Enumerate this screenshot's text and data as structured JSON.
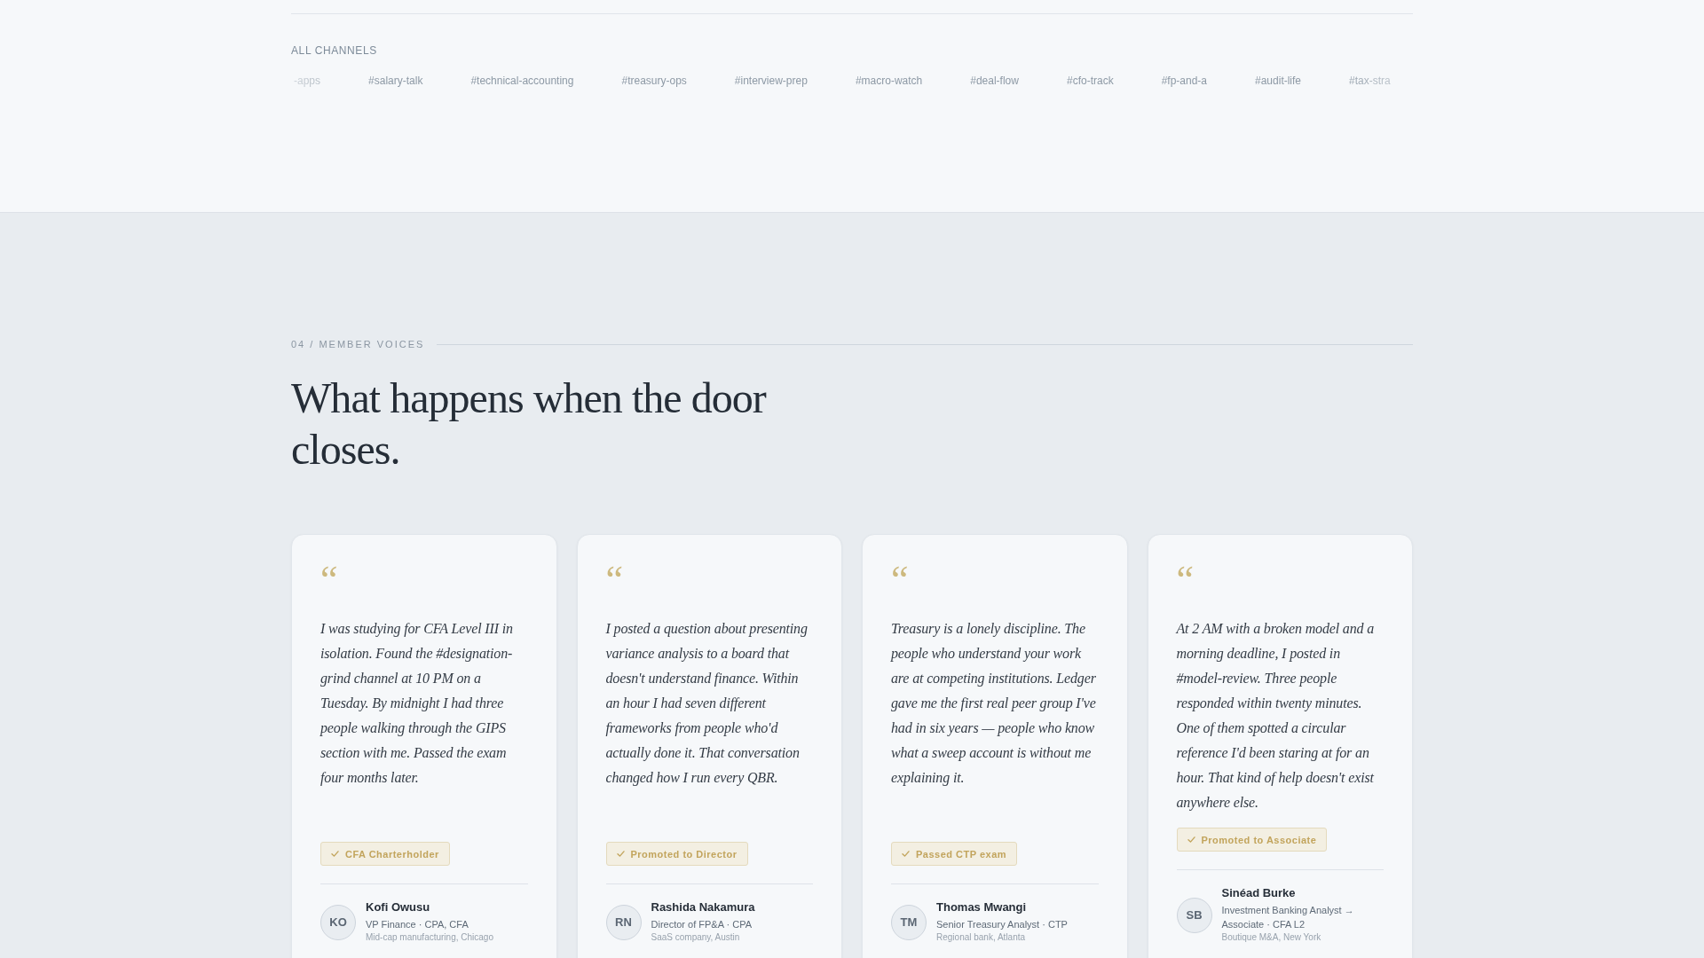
{
  "channels_strip": {
    "heading": "ALL CHANNELS",
    "channels": [
      "-apps",
      "#salary-talk",
      "#technical-accounting",
      "#treasury-ops",
      "#interview-prep",
      "#macro-watch",
      "#deal-flow",
      "#cfo-track",
      "#fp-and-a",
      "#audit-life",
      "#tax-stra"
    ]
  },
  "section": {
    "eyebrow": "04 / MEMBER VOICES",
    "title": "What happens when the door closes."
  },
  "testimonials": [
    {
      "quote_mark": "“",
      "quote": "I was studying for CFA Level III in isolation. Found the #designation-grind channel at 10 PM on a Tuesday. By midnight I had three people walking through the GIPS section with me. Passed the exam four months later.",
      "outcome": "CFA Charterholder",
      "initials": "KO",
      "name": "Kofi Owusu",
      "role": "VP Finance · CPA, CFA",
      "company": "Mid-cap manufacturing, Chicago"
    },
    {
      "quote_mark": "“",
      "quote": "I posted a question about presenting variance analysis to a board that doesn't understand finance. Within an hour I had seven different frameworks from people who'd actually done it. That conversation changed how I run every QBR.",
      "outcome": "Promoted to Director",
      "initials": "RN",
      "name": "Rashida Nakamura",
      "role": "Director of FP&A · CPA",
      "company": "SaaS company, Austin"
    },
    {
      "quote_mark": "“",
      "quote": "Treasury is a lonely discipline. The people who understand your work are at competing institutions. Ledger gave me the first real peer group I've had in six years — people who know what a sweep account is without me explaining it.",
      "outcome": "Passed CTP exam",
      "initials": "TM",
      "name": "Thomas Mwangi",
      "role": "Senior Treasury Analyst · CTP",
      "company": "Regional bank, Atlanta"
    },
    {
      "quote_mark": "“",
      "quote": "At 2 AM with a broken model and a morning deadline, I posted in #model-review. Three people responded within twenty minutes. One of them spotted a circular reference I'd been staring at for an hour. That kind of help doesn't exist anywhere else.",
      "outcome": "Promoted to Associate",
      "initials": "SB",
      "name": "Sinéad Burke",
      "role": "Investment Banking Analyst → Associate · CFA L2",
      "company": "Boutique M&A, New York"
    }
  ]
}
